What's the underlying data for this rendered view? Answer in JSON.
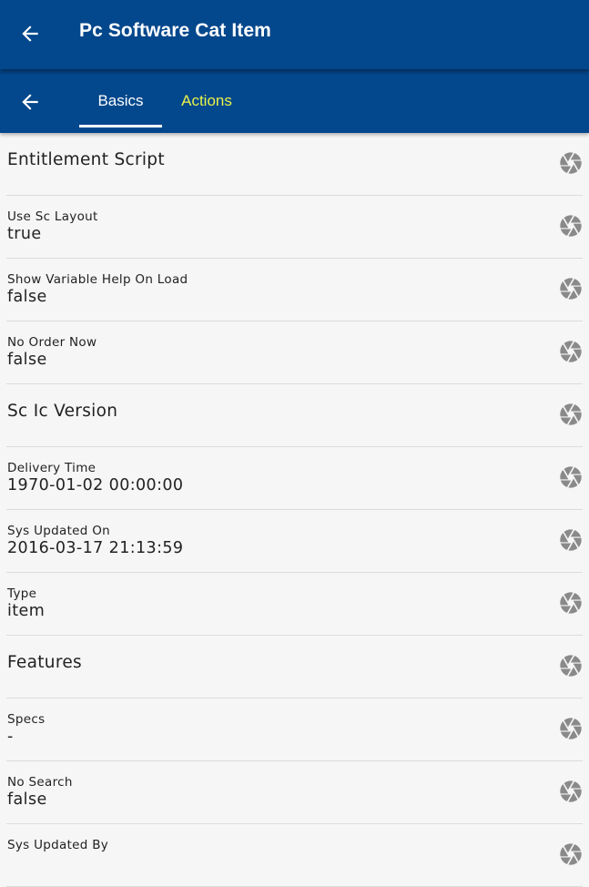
{
  "app_bar": {
    "title": "Pc Software Cat Item",
    "back_icon": "arrow-left-icon"
  },
  "tab_bar": {
    "back_icon": "arrow-left-icon",
    "tabs": [
      {
        "label": "Basics",
        "selected": true,
        "color": "#ffffff"
      },
      {
        "label": "Actions",
        "selected": false,
        "color": "#e8f24c"
      }
    ]
  },
  "colors": {
    "primary": "#03478c",
    "active_tab_text": "#ffffff",
    "inactive_tab_text": "#e8f24c",
    "icon": "#8a8a8a",
    "background": "#f6f6f6"
  },
  "rows": [
    {
      "type": "header",
      "label": "Entitlement Script",
      "icon": "aperture-icon"
    },
    {
      "type": "field",
      "label": "Use Sc Layout",
      "value": "true",
      "icon": "aperture-icon"
    },
    {
      "type": "field",
      "label": "Show Variable Help On Load",
      "value": "false",
      "icon": "aperture-icon"
    },
    {
      "type": "field",
      "label": "No Order Now",
      "value": "false",
      "icon": "aperture-icon"
    },
    {
      "type": "header",
      "label": "Sc Ic Version",
      "icon": "aperture-icon"
    },
    {
      "type": "field",
      "label": "Delivery Time",
      "value": "1970-01-02 00:00:00",
      "icon": "aperture-icon"
    },
    {
      "type": "field",
      "label": "Sys Updated On",
      "value": "2016-03-17 21:13:59",
      "icon": "aperture-icon"
    },
    {
      "type": "field",
      "label": "Type",
      "value": "item",
      "icon": "aperture-icon"
    },
    {
      "type": "header",
      "label": "Features",
      "icon": "aperture-icon"
    },
    {
      "type": "field",
      "label": "Specs",
      "value": "-",
      "icon": "aperture-icon"
    },
    {
      "type": "field",
      "label": "No Search",
      "value": "false",
      "icon": "aperture-icon"
    },
    {
      "type": "field",
      "label": "Sys Updated By",
      "value": "",
      "icon": "aperture-icon"
    }
  ]
}
